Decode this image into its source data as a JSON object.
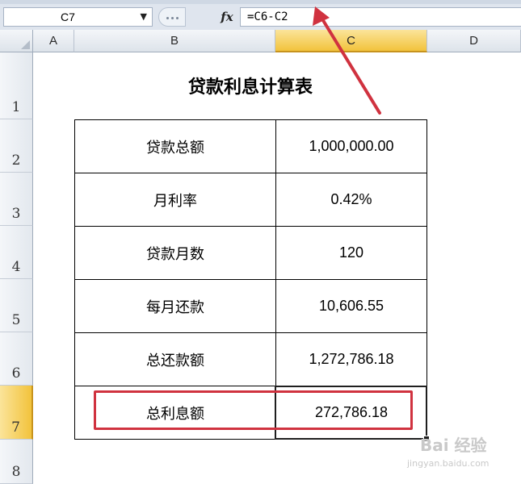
{
  "formula_bar": {
    "name_box": "C7",
    "fx_label": "fx",
    "formula": "=C6-C2"
  },
  "columns": [
    "A",
    "B",
    "C",
    "D"
  ],
  "rows": [
    "1",
    "2",
    "3",
    "4",
    "5",
    "6",
    "7",
    "8"
  ],
  "selected_cell": "C7",
  "sheet": {
    "title": "贷款利息计算表",
    "table": [
      {
        "label": "贷款总额",
        "value": "1,000,000.00"
      },
      {
        "label": "月利率",
        "value": "0.42%"
      },
      {
        "label": "贷款月数",
        "value": "120"
      },
      {
        "label": "每月还款",
        "value": "10,606.55"
      },
      {
        "label": "总还款额",
        "value": "1,272,786.18"
      },
      {
        "label": "总利息额",
        "value": "272,786.18"
      }
    ]
  },
  "watermark": {
    "brand": "Bai 经验",
    "url": "jingyan.baidu.com"
  },
  "colors": {
    "highlight_box": "#d0323f",
    "arrow": "#d0323f",
    "selected_header": "#f2c33c"
  }
}
